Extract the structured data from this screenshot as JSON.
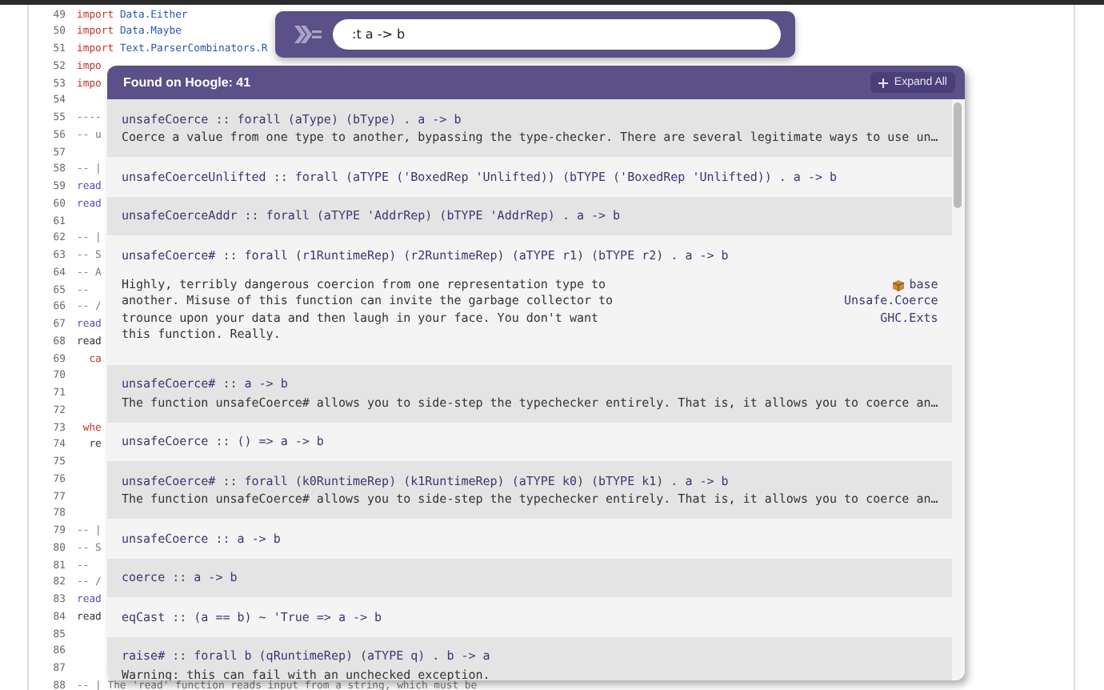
{
  "editor": {
    "lines": [
      {
        "number": "49",
        "tokens": [
          {
            "text": "import ",
            "kind": "keyword"
          },
          {
            "text": "Data.Either",
            "kind": "module"
          }
        ]
      },
      {
        "number": "50",
        "tokens": [
          {
            "text": "import ",
            "kind": "keyword"
          },
          {
            "text": "Data.Maybe",
            "kind": "module"
          }
        ]
      },
      {
        "number": "51",
        "tokens": [
          {
            "text": "import ",
            "kind": "keyword"
          },
          {
            "text": "Text.ParserCombinators.R",
            "kind": "module"
          }
        ]
      },
      {
        "number": "52",
        "tokens": [
          {
            "text": "impo",
            "kind": "keyword"
          }
        ]
      },
      {
        "number": "53",
        "tokens": [
          {
            "text": "impo",
            "kind": "keyword"
          }
        ]
      },
      {
        "number": "54"
      },
      {
        "number": "55",
        "tokens": [
          {
            "text": "----",
            "kind": "comment"
          }
        ]
      },
      {
        "number": "56",
        "tokens": [
          {
            "text": "-- u",
            "kind": "comment"
          }
        ]
      },
      {
        "number": "57"
      },
      {
        "number": "58",
        "tokens": [
          {
            "text": "-- |",
            "kind": "comment"
          }
        ]
      },
      {
        "number": "59",
        "tokens": [
          {
            "text": "read",
            "kind": "function"
          }
        ]
      },
      {
        "number": "60",
        "tokens": [
          {
            "text": "read",
            "kind": "function"
          }
        ]
      },
      {
        "number": "61"
      },
      {
        "number": "62",
        "tokens": [
          {
            "text": "-- |",
            "kind": "comment"
          }
        ]
      },
      {
        "number": "63",
        "tokens": [
          {
            "text": "-- S",
            "kind": "comment"
          }
        ]
      },
      {
        "number": "64",
        "tokens": [
          {
            "text": "-- A",
            "kind": "comment"
          }
        ]
      },
      {
        "number": "65",
        "tokens": [
          {
            "text": "--",
            "kind": "comment"
          }
        ]
      },
      {
        "number": "66",
        "tokens": [
          {
            "text": "-- /",
            "kind": "comment"
          }
        ]
      },
      {
        "number": "67",
        "tokens": [
          {
            "text": "read",
            "kind": "function"
          }
        ]
      },
      {
        "number": "68",
        "tokens": [
          {
            "text": "read",
            "kind": "plain"
          }
        ]
      },
      {
        "number": "69",
        "tokens": [
          {
            "text": "  ca",
            "kind": "keyword"
          }
        ]
      },
      {
        "number": "70"
      },
      {
        "number": "71"
      },
      {
        "number": "72"
      },
      {
        "number": "73",
        "tokens": [
          {
            "text": " whe",
            "kind": "keyword"
          }
        ]
      },
      {
        "number": "74",
        "tokens": [
          {
            "text": "  re",
            "kind": "plain"
          }
        ]
      },
      {
        "number": "75"
      },
      {
        "number": "76"
      },
      {
        "number": "77"
      },
      {
        "number": "78"
      },
      {
        "number": "79",
        "tokens": [
          {
            "text": "-- |",
            "kind": "comment"
          }
        ]
      },
      {
        "number": "80",
        "tokens": [
          {
            "text": "-- S",
            "kind": "comment"
          }
        ]
      },
      {
        "number": "81",
        "tokens": [
          {
            "text": "--",
            "kind": "comment"
          }
        ]
      },
      {
        "number": "82",
        "tokens": [
          {
            "text": "-- /",
            "kind": "comment"
          }
        ]
      },
      {
        "number": "83",
        "tokens": [
          {
            "text": "read",
            "kind": "function"
          }
        ]
      },
      {
        "number": "84",
        "tokens": [
          {
            "text": "read",
            "kind": "plain"
          }
        ]
      },
      {
        "number": "85"
      },
      {
        "number": "86"
      },
      {
        "number": "87"
      },
      {
        "number": "88",
        "tokens": [
          {
            "text": "-- | The 'read' function reads input from a string, which must be",
            "kind": "comment"
          }
        ]
      }
    ]
  },
  "search": {
    "value": ":t a -> b"
  },
  "results": {
    "title": "Found on Hoogle: 41",
    "expand_all": "Expand All",
    "items": [
      {
        "signature": "unsafeCoerce :: forall (aType) (bType) . a -> b",
        "description": "Coerce a value from one type to another, bypassing the type-checker. There are several legitimate ways to use un…",
        "expanded": false
      },
      {
        "signature": "unsafeCoerceUnlifted :: forall (aTYPE ('BoxedRep 'Unlifted)) (bTYPE ('BoxedRep 'Unlifted)) . a -> b",
        "expanded": false
      },
      {
        "signature": "unsafeCoerceAddr :: forall (aTYPE 'AddrRep) (bTYPE 'AddrRep) . a -> b",
        "expanded": false
      },
      {
        "signature": "unsafeCoerce# :: forall (r1RuntimeRep) (r2RuntimeRep) (aTYPE r1) (bTYPE r2) . a -> b",
        "description": "Highly, terribly dangerous coercion from one representation type to another. Misuse of this function can invite the garbage collector to trounce upon your data and then laugh in your face. You don't want this function. Really.",
        "expanded": true,
        "package": "base",
        "modules": [
          "Unsafe.Coerce",
          "GHC.Exts"
        ]
      },
      {
        "signature": "unsafeCoerce# :: a -> b",
        "description": "The function unsafeCoerce# allows you to side-step the typechecker entirely. That is, it allows you to coerce an…",
        "expanded": false
      },
      {
        "signature": "unsafeCoerce :: () => a -> b",
        "expanded": false
      },
      {
        "signature": "unsafeCoerce# :: forall (k0RuntimeRep) (k1RuntimeRep) (aTYPE k0) (bTYPE k1) . a -> b",
        "description": "The function unsafeCoerce# allows you to side-step the typechecker entirely. That is, it allows you to coerce an…",
        "expanded": false
      },
      {
        "signature": "unsafeCoerce :: a -> b",
        "expanded": false
      },
      {
        "signature": "coerce :: a -> b",
        "expanded": false
      },
      {
        "signature": "eqCast :: (a == b) ~ 'True => a -> b",
        "expanded": false
      },
      {
        "signature": "raise# :: forall b (qRuntimeRep) (aTYPE q) . b -> a",
        "description": "Warning: this can fail with an unchecked exception.",
        "expanded": false
      }
    ]
  }
}
